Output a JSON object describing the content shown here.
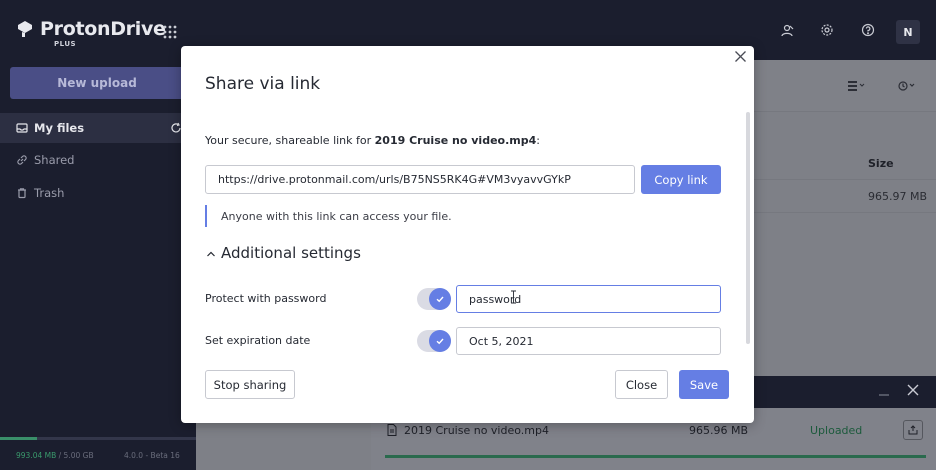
{
  "app": {
    "logo_text": "ProtonDrive",
    "logo_sub": "PLUS",
    "logo_icon": "proton-logo-icon",
    "apps_icon": "apps-grid-icon"
  },
  "sidebar": {
    "new_upload_label": "New upload",
    "items": [
      {
        "label": "My files",
        "icon": "inbox-icon",
        "active": true
      },
      {
        "label": "Shared",
        "icon": "link-icon",
        "active": false
      },
      {
        "label": "Trash",
        "icon": "trash-icon",
        "active": false
      }
    ],
    "storage_used": "993.04 MB",
    "storage_total": " / 5.00 GB",
    "storage_fraction": 0.19,
    "version": "4.0.0 - Beta 16"
  },
  "topbar": {
    "avatar_initial": "N",
    "icons": [
      "contacts-icon",
      "settings-icon",
      "help-icon"
    ]
  },
  "file_table": {
    "size_header": "Size",
    "rows": [
      {
        "size": "965.97 MB"
      }
    ]
  },
  "upload_panel": {
    "file_name": "2019 Cruise no video.mp4",
    "file_size": "965.96 MB",
    "status": "Uploaded",
    "progress": 1.0
  },
  "modal": {
    "title": "Share via link",
    "desc_prefix": "Your secure, shareable link for ",
    "file_name": "2019 Cruise no video.mp4",
    "desc_suffix": ":",
    "link": "https://drive.protonmail.com/urls/B75NS5RK4G#VM3vyavvGYkP",
    "copy_label": "Copy link",
    "notice": "Anyone with this link can access your file.",
    "additional_settings": "Additional settings",
    "password_label": "Protect with password",
    "password_value": "password",
    "password_enabled": true,
    "expiration_label": "Set expiration date",
    "expiration_value": "Oct 5, 2021",
    "expiration_enabled": true,
    "stop_label": "Stop sharing",
    "close_label": "Close",
    "save_label": "Save",
    "accent": "#657ee4"
  }
}
